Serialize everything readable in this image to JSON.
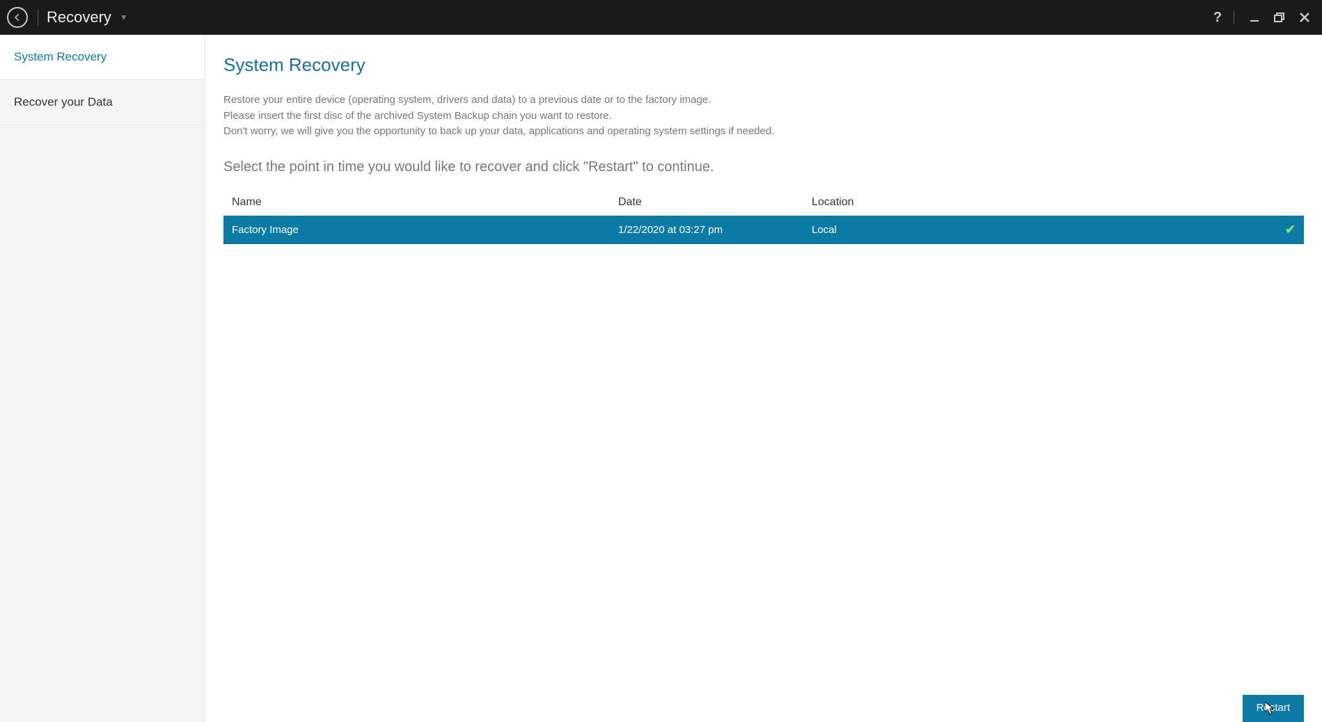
{
  "header": {
    "title": "Recovery"
  },
  "sidebar": {
    "items": [
      {
        "label": "System Recovery",
        "active": true
      },
      {
        "label": "Recover your Data",
        "active": false
      }
    ]
  },
  "main": {
    "title": "System Recovery",
    "description_line1": "Restore your entire device (operating system, drivers and data) to a previous date or to the factory image.",
    "description_line2": "Please insert the first disc of the archived System Backup chain you want to restore.",
    "description_line3": "Don't worry, we will give you the opportunity to back up your data, applications and operating system settings if needed.",
    "subheading": "Select the point in time you would like to recover and click \"Restart\" to continue.",
    "table": {
      "headers": {
        "name": "Name",
        "date": "Date",
        "location": "Location"
      },
      "rows": [
        {
          "name": "Factory Image",
          "date": "1/22/2020 at 03:27 pm",
          "location": "Local",
          "selected": true
        }
      ]
    },
    "restart_label": "Restart"
  }
}
